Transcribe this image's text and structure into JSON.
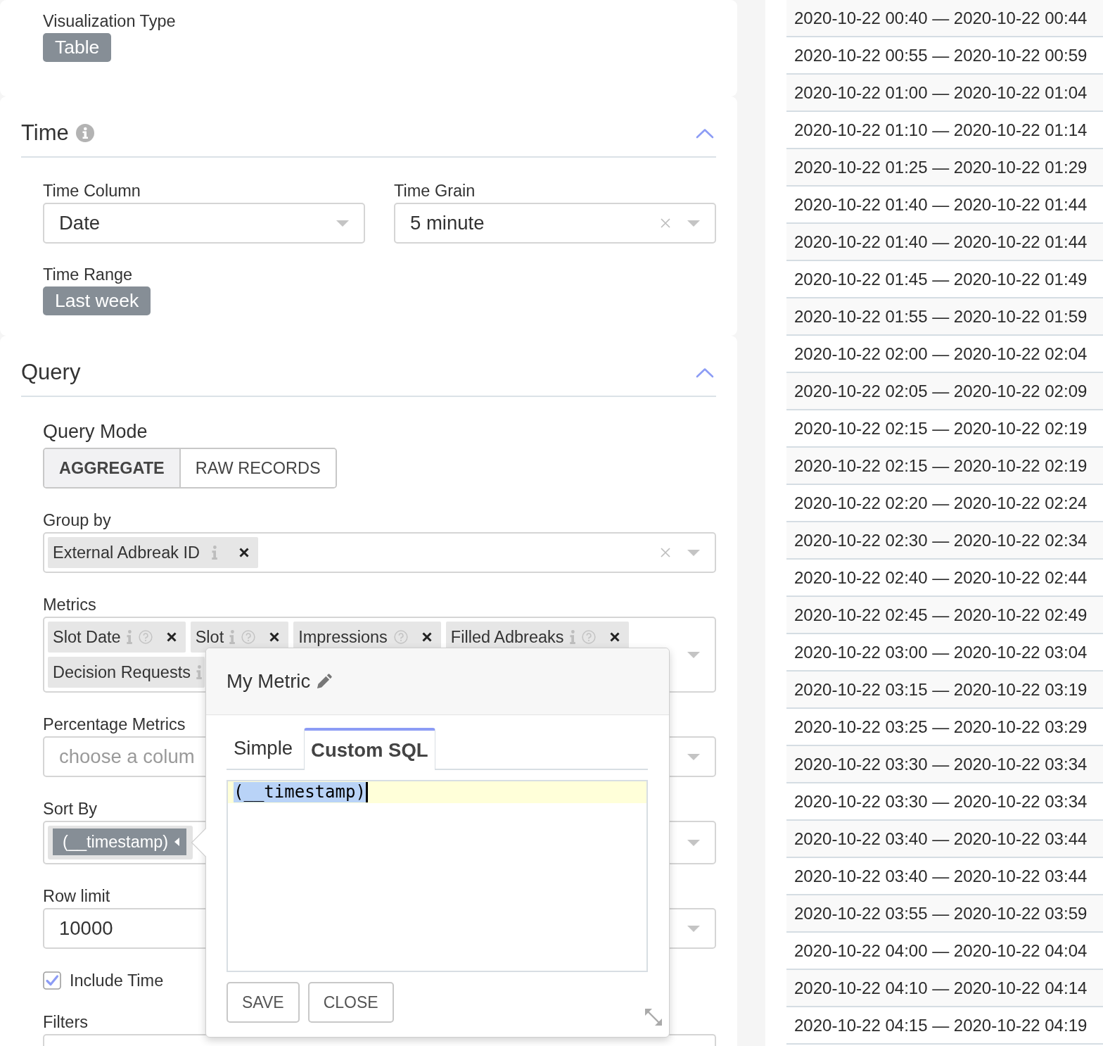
{
  "visualization_type": {
    "label": "Visualization Type",
    "value": "Table"
  },
  "time_section": {
    "title": "Time",
    "info": true,
    "expanded": true,
    "time_column": {
      "label": "Time Column",
      "value": "Date",
      "clearable": false
    },
    "time_grain": {
      "label": "Time Grain",
      "value": "5 minute",
      "clearable": true
    },
    "time_range": {
      "label": "Time Range",
      "value": "Last week"
    }
  },
  "query_section": {
    "title": "Query",
    "expanded": true,
    "query_mode": {
      "label": "Query Mode",
      "options": [
        {
          "label": "AGGREGATE",
          "selected": true
        },
        {
          "label": "RAW RECORDS",
          "selected": false
        }
      ]
    },
    "group_by": {
      "label": "Group by",
      "clearable": true,
      "tags": [
        {
          "label": "External Adbreak ID",
          "info": true,
          "help": false,
          "removable": true
        }
      ]
    },
    "metrics": {
      "label": "Metrics",
      "clearable": false,
      "tags": [
        {
          "label": "Slot Date",
          "info": true,
          "help": true,
          "removable": true
        },
        {
          "label": "Slot",
          "info": true,
          "help": true,
          "removable": true
        },
        {
          "label": "Impressions",
          "info": false,
          "help": true,
          "removable": true
        },
        {
          "label": "Filled Adbreaks",
          "info": true,
          "help": true,
          "removable": true
        },
        {
          "label": "Decision Requests",
          "info": true,
          "help": false,
          "removable": false
        }
      ]
    },
    "percentage_metrics": {
      "label": "Percentage Metrics",
      "placeholder": "choose a colum"
    },
    "sort_by": {
      "label": "Sort By",
      "tags": [
        {
          "label": "(__timestamp)"
        }
      ]
    },
    "row_limit": {
      "label": "Row limit",
      "value": "10000"
    },
    "include_time": {
      "label": "Include Time",
      "checked": true
    },
    "filters": {
      "label": "Filters"
    }
  },
  "metric_popover": {
    "title": "My Metric",
    "tabs": [
      {
        "label": "Simple",
        "selected": false
      },
      {
        "label": "Custom SQL",
        "selected": true
      }
    ],
    "sql": {
      "text": "(__timestamp)",
      "selected": true
    },
    "buttons": [
      {
        "label": "SAVE"
      },
      {
        "label": "CLOSE"
      }
    ]
  },
  "results_table": {
    "rows": [
      "2020-10-22 00:40 — 2020-10-22 00:44",
      "2020-10-22 00:55 — 2020-10-22 00:59",
      "2020-10-22 01:00 — 2020-10-22 01:04",
      "2020-10-22 01:10 — 2020-10-22 01:14",
      "2020-10-22 01:25 — 2020-10-22 01:29",
      "2020-10-22 01:40 — 2020-10-22 01:44",
      "2020-10-22 01:40 — 2020-10-22 01:44",
      "2020-10-22 01:45 — 2020-10-22 01:49",
      "2020-10-22 01:55 — 2020-10-22 01:59",
      "2020-10-22 02:00 — 2020-10-22 02:04",
      "2020-10-22 02:05 — 2020-10-22 02:09",
      "2020-10-22 02:15 — 2020-10-22 02:19",
      "2020-10-22 02:15 — 2020-10-22 02:19",
      "2020-10-22 02:20 — 2020-10-22 02:24",
      "2020-10-22 02:30 — 2020-10-22 02:34",
      "2020-10-22 02:40 — 2020-10-22 02:44",
      "2020-10-22 02:45 — 2020-10-22 02:49",
      "2020-10-22 03:00 — 2020-10-22 03:04",
      "2020-10-22 03:15 — 2020-10-22 03:19",
      "2020-10-22 03:25 — 2020-10-22 03:29",
      "2020-10-22 03:30 — 2020-10-22 03:34",
      "2020-10-22 03:30 — 2020-10-22 03:34",
      "2020-10-22 03:40 — 2020-10-22 03:44",
      "2020-10-22 03:40 — 2020-10-22 03:44",
      "2020-10-22 03:55 — 2020-10-22 03:59",
      "2020-10-22 04:00 — 2020-10-22 04:04",
      "2020-10-22 04:10 — 2020-10-22 04:14",
      "2020-10-22 04:15 — 2020-10-22 04:19"
    ]
  }
}
